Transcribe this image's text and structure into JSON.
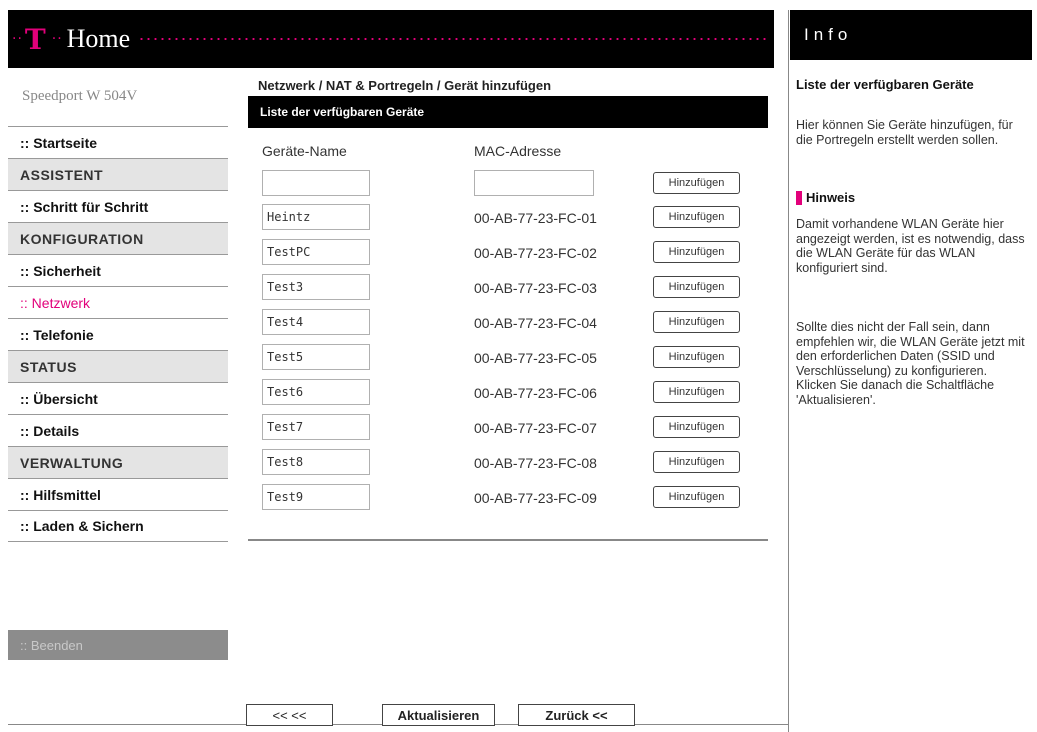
{
  "header": {
    "logo_letter": "T",
    "title": "Home",
    "info_title": "Info"
  },
  "sidebar": {
    "model": "Speedport W 504V",
    "items": [
      {
        "label": ":: Startseite",
        "kind": "link"
      },
      {
        "label": "ASSISTENT",
        "kind": "section"
      },
      {
        "label": ":: Schritt für Schritt",
        "kind": "link"
      },
      {
        "label": "KONFIGURATION",
        "kind": "section"
      },
      {
        "label": ":: Sicherheit",
        "kind": "link"
      },
      {
        "label": ":: Netzwerk",
        "kind": "link",
        "active": true
      },
      {
        "label": ":: Telefonie",
        "kind": "link"
      },
      {
        "label": "STATUS",
        "kind": "section"
      },
      {
        "label": ":: Übersicht",
        "kind": "link"
      },
      {
        "label": ":: Details",
        "kind": "link"
      },
      {
        "label": "VERWALTUNG",
        "kind": "section"
      },
      {
        "label": ":: Hilfsmittel",
        "kind": "link"
      },
      {
        "label": ":: Laden & Sichern",
        "kind": "link"
      }
    ],
    "logout_label": ":: Beenden"
  },
  "main": {
    "breadcrumb": "Netzwerk / NAT & Portregeln / Gerät hinzufügen",
    "section_title": "Liste der verfügbaren Geräte",
    "col_name": "Geräte-Name",
    "col_mac": "MAC-Adresse",
    "add_label": "Hinzufügen",
    "new_device_name": "",
    "new_device_mac": "",
    "devices": [
      {
        "name": "Heintz",
        "mac": "00-AB-77-23-FC-01"
      },
      {
        "name": "TestPC",
        "mac": "00-AB-77-23-FC-02"
      },
      {
        "name": "Test3",
        "mac": "00-AB-77-23-FC-03"
      },
      {
        "name": "Test4",
        "mac": "00-AB-77-23-FC-04"
      },
      {
        "name": "Test5",
        "mac": "00-AB-77-23-FC-05"
      },
      {
        "name": "Test6",
        "mac": "00-AB-77-23-FC-06"
      },
      {
        "name": "Test7",
        "mac": "00-AB-77-23-FC-07"
      },
      {
        "name": "Test8",
        "mac": "00-AB-77-23-FC-08"
      },
      {
        "name": "Test9",
        "mac": "00-AB-77-23-FC-09"
      }
    ],
    "btn_back": "<< <<",
    "btn_update": "Aktualisieren",
    "btn_zurueck": "Zurück <<"
  },
  "info": {
    "title": "Liste der verfügbaren Geräte",
    "text": "Hier können Sie Geräte hinzufügen, für die Portregeln erstellt werden sollen.",
    "hinweis_title": "Hinweis",
    "hinweis_text1": "Damit vorhandene WLAN Geräte hier angezeigt werden, ist es notwendig, dass die WLAN Geräte für das WLAN konfiguriert sind.",
    "hinweis_text2": "Sollte dies nicht der Fall sein, dann empfehlen wir, die WLAN Geräte jetzt mit den erforderlichen Daten (SSID und Verschlüsselung) zu konfigurieren. Klicken Sie danach die Schaltfläche 'Aktualisieren'."
  },
  "colors": {
    "brand_magenta": "#e2007a",
    "header_black": "#000000",
    "section_gray": "#e4e4e4"
  }
}
